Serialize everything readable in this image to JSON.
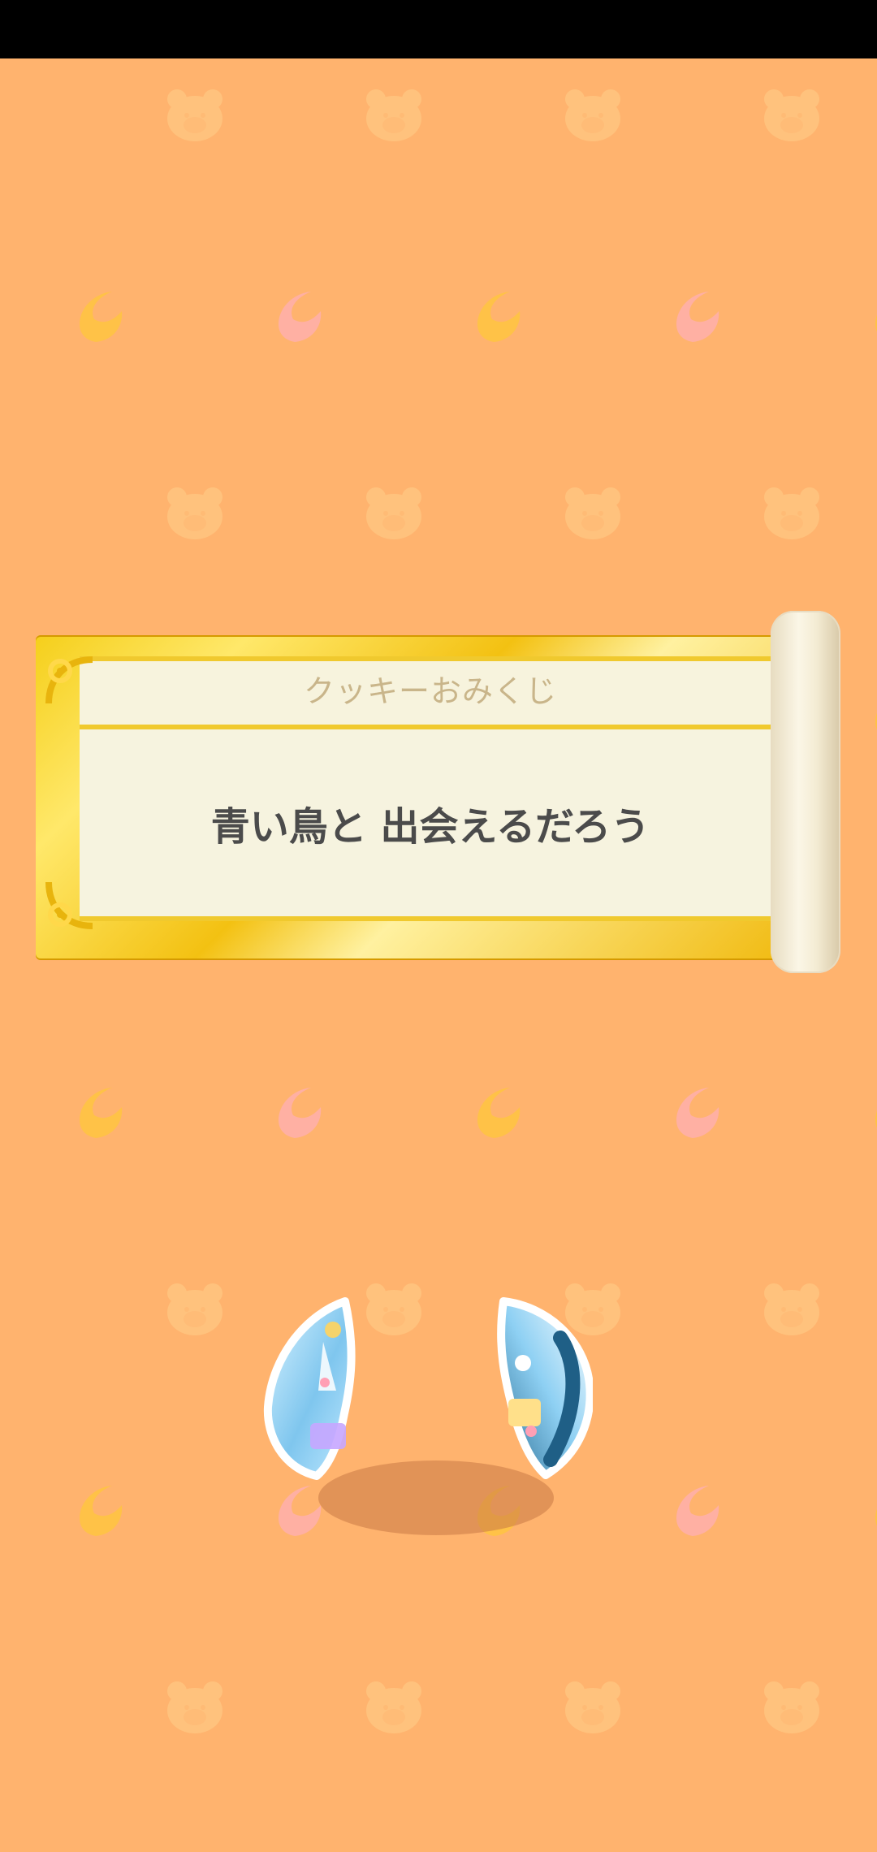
{
  "banner": {
    "title": "クッキーおみくじ",
    "message": "青い鳥と 出会えるだろう"
  },
  "icons": {
    "pattern_bear": "bear-face-icon",
    "pattern_moon": "crescent-moon-icon",
    "ornament": "gold-swirl-ornament-icon"
  },
  "colors": {
    "background": "#ffb36e",
    "pattern_light": "#ffc27d",
    "pattern_pink": "#ffb0a3",
    "pattern_yellow": "#ffc247",
    "gold": "#f3c112",
    "paper": "#f6f3df",
    "text_title": "#c9b58a",
    "text_message": "#4b4b4b"
  }
}
